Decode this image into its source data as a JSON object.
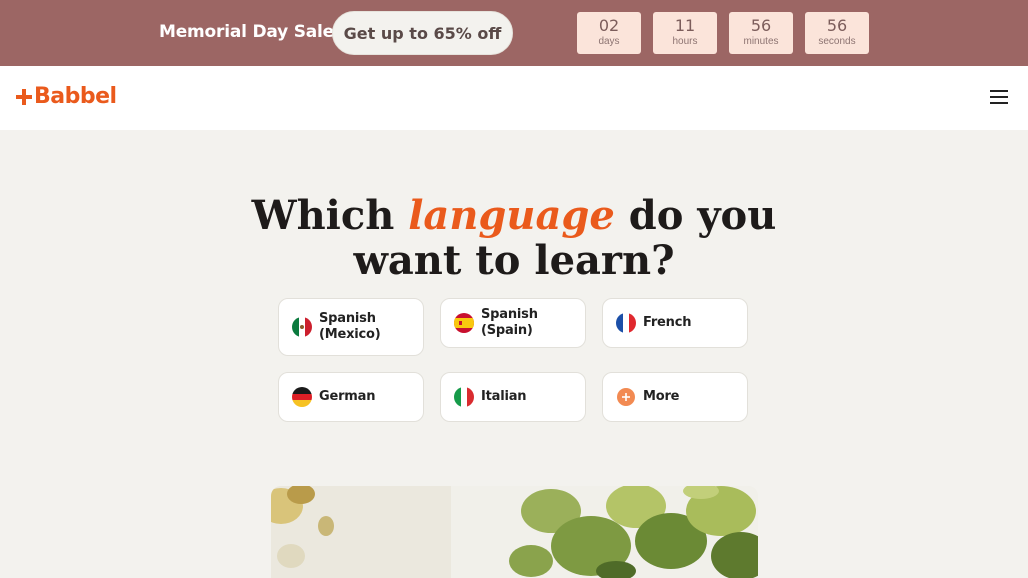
{
  "promo": {
    "title": "Memorial Day Sale!",
    "cta": "Get up to 65% off",
    "countdown": [
      {
        "value": "02",
        "unit": "days"
      },
      {
        "value": "11",
        "unit": "hours"
      },
      {
        "value": "56",
        "unit": "minutes"
      },
      {
        "value": "56",
        "unit": "seconds"
      }
    ]
  },
  "header": {
    "logo": "Babbel",
    "menu_icon": "hamburger-menu-icon"
  },
  "heading": {
    "before": "Which ",
    "highlight": "language",
    "after_line1": " do you",
    "line2": "want to learn?"
  },
  "languages": [
    {
      "label": "Spanish (Mexico)",
      "icon": "mexico-flag-icon"
    },
    {
      "label": "Spanish (Spain)",
      "icon": "spain-flag-icon"
    },
    {
      "label": "French",
      "icon": "france-flag-icon"
    },
    {
      "label": "German",
      "icon": "germany-flag-icon"
    },
    {
      "label": "Italian",
      "icon": "italy-flag-icon"
    },
    {
      "label": "More",
      "icon": "plus-icon"
    }
  ],
  "colors": {
    "promo_bg": "#9c6664",
    "accent": "#ea5a1c",
    "page_bg": "#f3f2ee"
  }
}
